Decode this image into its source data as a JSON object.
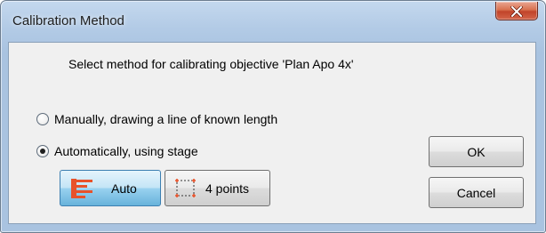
{
  "window": {
    "title": "Calibration Method",
    "close_label": "Close"
  },
  "dialog": {
    "prompt": "Select method for calibrating objective 'Plan Apo 4x'",
    "options": [
      {
        "label": "Manually, drawing a line of known length",
        "checked": false
      },
      {
        "label": "Automatically, using stage",
        "checked": true
      }
    ],
    "mode_buttons": [
      {
        "label": "Auto",
        "icon": "auto-align-icon",
        "pressed": true
      },
      {
        "label": "4 points",
        "icon": "four-points-icon",
        "pressed": false
      }
    ],
    "ok_label": "OK",
    "cancel_label": "Cancel"
  },
  "colors": {
    "accent_icon": "#e8522a",
    "selection_blue": "#3c7fb1",
    "close_red": "#c1442a"
  }
}
